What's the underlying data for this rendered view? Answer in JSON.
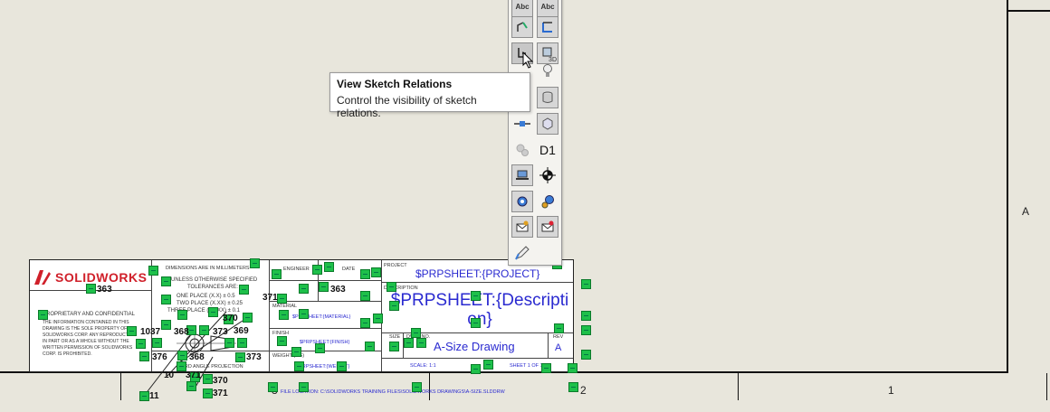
{
  "tooltip": {
    "title": "View Sketch Relations",
    "description": "Control the visibility of sketch relations."
  },
  "toolbar": {
    "buttons": [
      {
        "name": "annotation-note-icon",
        "label": "Abc"
      },
      {
        "name": "annotation-note-alt-icon",
        "label": "Abc"
      },
      {
        "name": "edit-sketch-icon",
        "label": ""
      },
      {
        "name": "sketch-outline-icon",
        "label": ""
      },
      {
        "name": "view-sketch-relations-icon",
        "label": ""
      },
      {
        "name": "view-3d-sketch-icon",
        "label": "3D"
      },
      {
        "name": "lightbulb-icon",
        "label": ""
      },
      {
        "name": "cylinder-view-icon",
        "label": ""
      },
      {
        "name": "connector-icon",
        "label": ""
      },
      {
        "name": "cube-view-icon",
        "label": ""
      },
      {
        "name": "gears-disabled-icon",
        "label": ""
      },
      {
        "name": "dimension-names-icon",
        "label": "D1"
      },
      {
        "name": "laptop-icon",
        "label": ""
      },
      {
        "name": "origin-icon",
        "label": ""
      },
      {
        "name": "gear-settings-icon",
        "label": ""
      },
      {
        "name": "gear-blue-icon",
        "label": ""
      },
      {
        "name": "mail-settings-icon",
        "label": ""
      },
      {
        "name": "mail-link-icon",
        "label": ""
      },
      {
        "name": "pencil-edit-icon",
        "label": ""
      }
    ]
  },
  "sheet": {
    "zone_right": "A",
    "zone_bottom_1": "1",
    "zone_bottom_2": "2",
    "zone_bottom_3": "3"
  },
  "title_block": {
    "logo_text": "SOLIDWORKS",
    "logo_prefix": "DS SOLID",
    "dimensions_header": "DIMENSIONS ARE IN MILLIMETERS",
    "unless": "UNLESS OTHERWISE SPECIFIED",
    "tolerances": "TOLERANCES ARE:",
    "one_place": "ONE PLACE (X.X) ± 0.5",
    "two_place": "TWO PLACE (X.XX) ± 0.25",
    "three_place": "THREE PLACE (X.XXX) ± 0.1",
    "proprietary": "PROPRIETARY AND CONFIDENTIAL",
    "info_text": "THE INFORMATION CONTAINED IN THIS DRAWING IS THE SOLE PROPERTY OF SOLIDWORKS CORP. ANY REPRODUCTION IN PART OR AS A WHOLE WITHOUT THE WRITTEN PERMISSION OF SOLIDWORKS CORP. IS PROHIBITED.",
    "projection": "THIRD ANGLE PROJECTION",
    "engineer": "ENGINEER",
    "date": "DATE",
    "material": "MATERIAL",
    "material_value": "$PRPSHEET:{MATERIAL}",
    "finish": "FINISH",
    "finish_value": "$PRPSHEET:{Finish}",
    "weight": "WEIGHT (kg)",
    "weight_value": "$PRPSHEET:{Weight}",
    "project_label": "PROJECT",
    "project_value": "$PRPSHEET:{PROJECT}",
    "description_label": "DESCRIPTION",
    "description_value": "$PRPSHEET:{Descripti on}",
    "description_line1": "$PRPSHEET:{Descripti",
    "description_line2": "on}",
    "size_label": "SIZE",
    "size_value": "A",
    "dwg_label": "DWG. NO.",
    "dwg_value": "A-Size Drawing",
    "rev_label": "REV",
    "rev_value": "A",
    "scale_label": "SCALE: 1:1",
    "sheet_label": "SHEET 1 OF 1",
    "file_location": "FILE LOCATION: C:\\SOLIDWORKS TRAINING FILES\\SOLIDWORKS DRAWINGS\\A-SIZE.SLDDRW"
  },
  "numbers": [
    "363",
    "363",
    "371",
    "369",
    "37",
    "10",
    "368",
    "373",
    "376",
    "368",
    "373",
    "10",
    "370",
    "371",
    "11",
    "370",
    "371"
  ]
}
